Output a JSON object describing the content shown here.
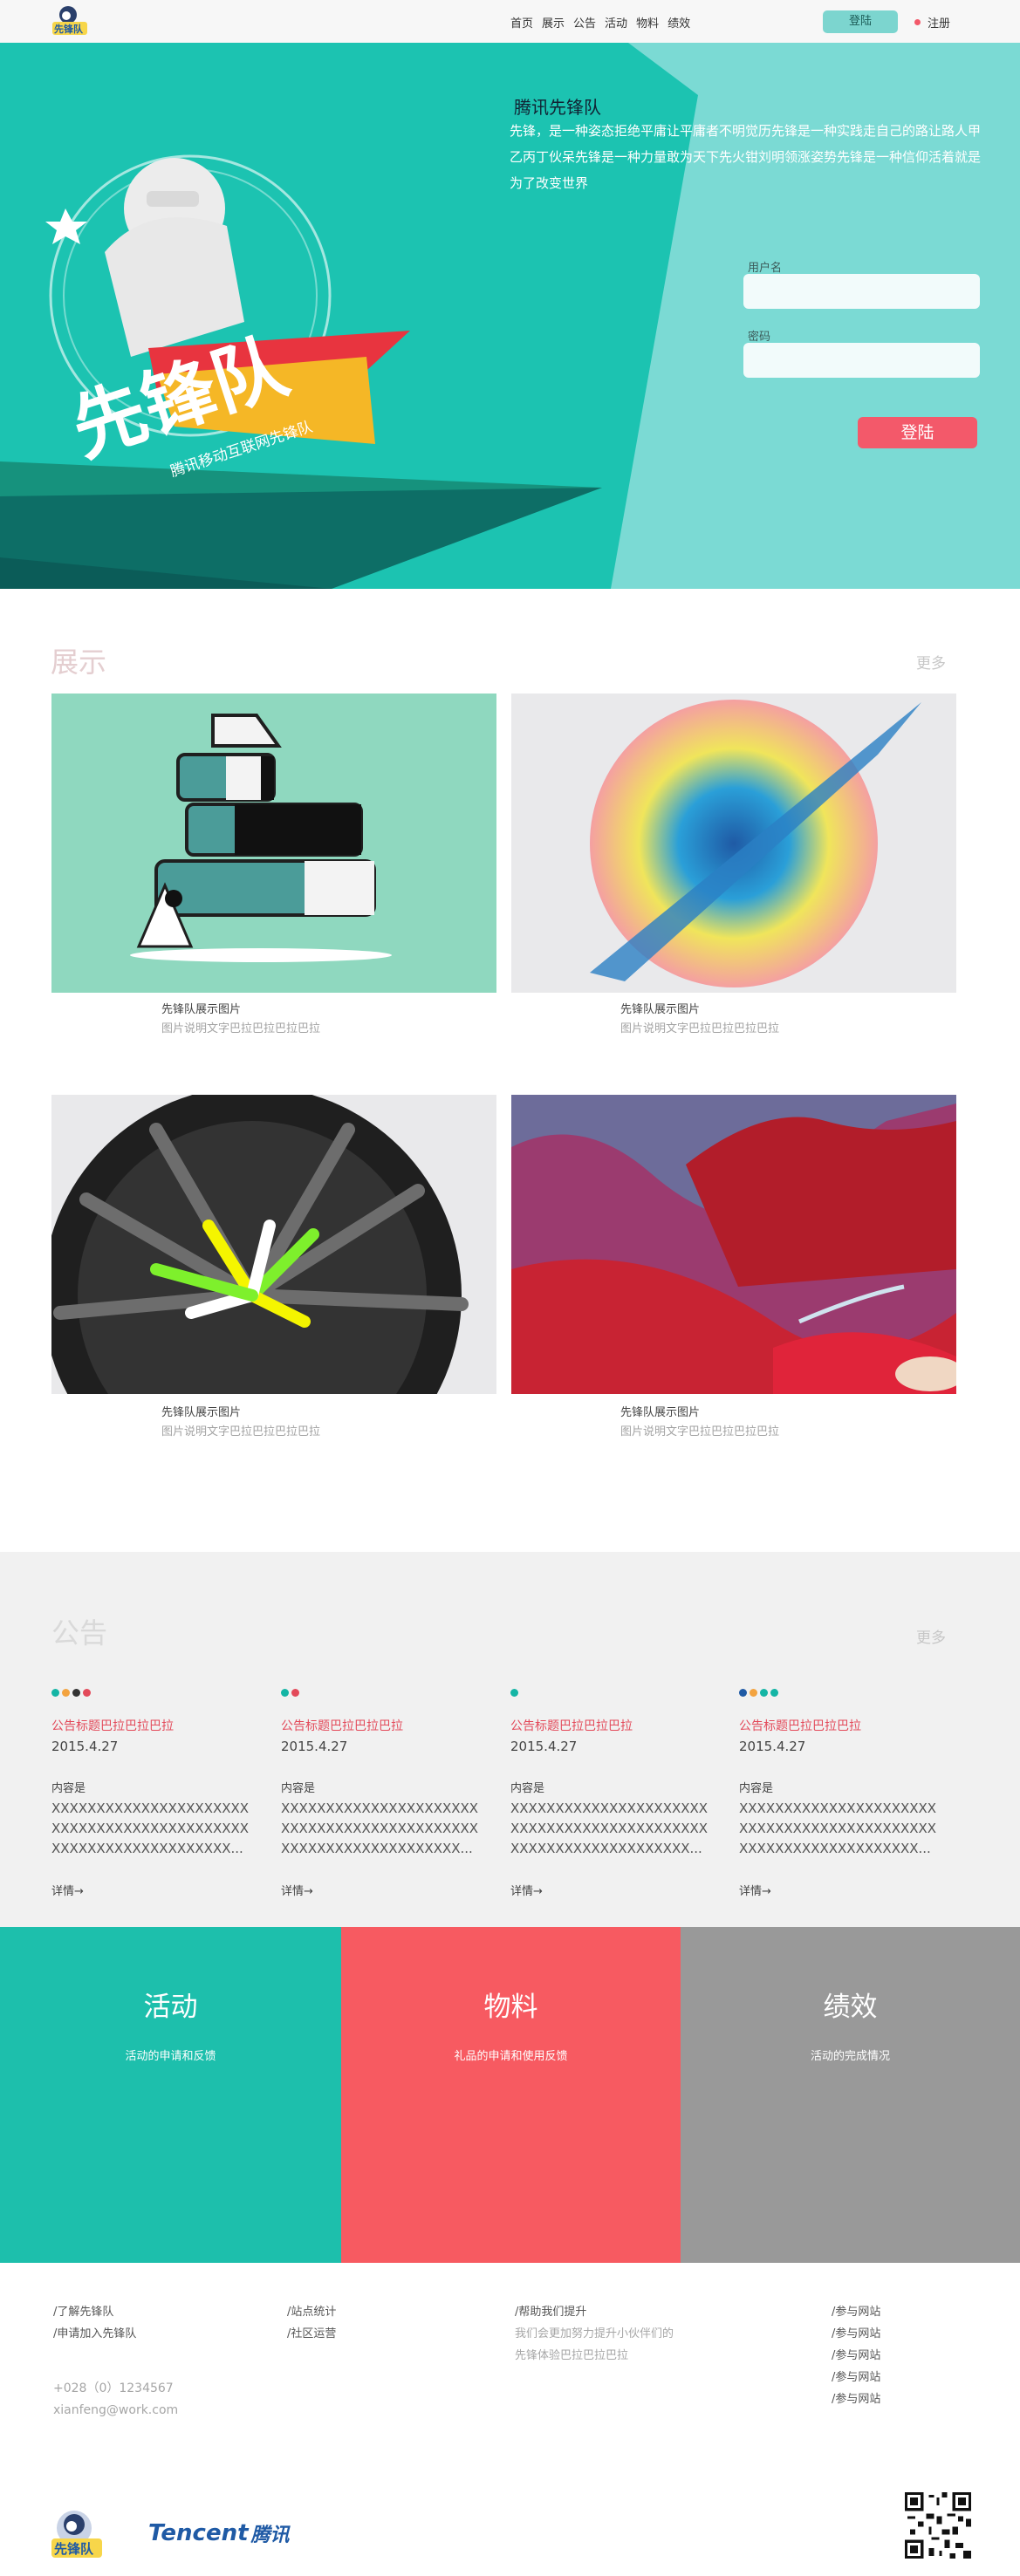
{
  "nav": {
    "logo_text": "先锋队",
    "links": [
      "首页",
      "展示",
      "公告",
      "活动",
      "物料",
      "绩效"
    ],
    "login_label": "登陆",
    "register_label": "注册"
  },
  "hero": {
    "logo_text": "先锋队",
    "logo_subtitle": "腾讯移动互联网先锋队",
    "title": "腾讯先锋队",
    "text": "先锋，是一种姿态拒绝平庸让平庸者不明觉历先锋是一种实践走自己的路让路人甲乙丙丁伙呆先锋是一种力量敢为天下先火钳刘明领涨姿势先锋是一种信仰活着就是为了改变世界",
    "username_label": "用户名",
    "password_label": "密码",
    "submit_label": "登陆"
  },
  "showcase": {
    "title": "展示",
    "more": "更多",
    "items": [
      {
        "title": "先锋队展示图片",
        "desc": "图片说明文字巴拉巴拉巴拉巴拉"
      },
      {
        "title": "先锋队展示图片",
        "desc": "图片说明文字巴拉巴拉巴拉巴拉"
      },
      {
        "title": "先锋队展示图片",
        "desc": "图片说明文字巴拉巴拉巴拉巴拉"
      },
      {
        "title": "先锋队展示图片",
        "desc": "图片说明文字巴拉巴拉巴拉巴拉"
      }
    ]
  },
  "notice": {
    "title": "公告",
    "more": "更多",
    "items": [
      {
        "title": "公告标题巴拉巴拉巴拉",
        "date": "2015.4.27",
        "content_label": "内容是",
        "content": "XXXXXXXXXXXXXXXXXXXXXXXXXXXXXXXXXXXXXXXXXXXXXXXXXXXXXXXXXXXXXXXX...",
        "more": "详情→",
        "dots": [
          "#14b5a5",
          "#f3a33f",
          "#333333",
          "#e34a5a"
        ]
      },
      {
        "title": "公告标题巴拉巴拉巴拉",
        "date": "2015.4.27",
        "content_label": "内容是",
        "content": "XXXXXXXXXXXXXXXXXXXXXXXXXXXXXXXXXXXXXXXXXXXXXXXXXXXXXXXXXXXXXXXX...",
        "more": "详情→",
        "dots": [
          "#14b5a5",
          "#e34a5a"
        ]
      },
      {
        "title": "公告标题巴拉巴拉巴拉",
        "date": "2015.4.27",
        "content_label": "内容是",
        "content": "XXXXXXXXXXXXXXXXXXXXXXXXXXXXXXXXXXXXXXXXXXXXXXXXXXXXXXXXXXXXXXXX...",
        "more": "详情→",
        "dots": [
          "#14b5a5"
        ]
      },
      {
        "title": "公告标题巴拉巴拉巴拉",
        "date": "2015.4.27",
        "content_label": "内容是",
        "content": "XXXXXXXXXXXXXXXXXXXXXXXXXXXXXXXXXXXXXXXXXXXXXXXXXXXXXXXXXXXXXXXX...",
        "more": "详情→",
        "dots": [
          "#1f5aa5",
          "#f3a33f",
          "#14b5a5",
          "#14b5a5"
        ]
      }
    ]
  },
  "features": [
    {
      "title": "活动",
      "subtitle": "活动的申请和反馈",
      "color": "#1dbfac"
    },
    {
      "title": "物料",
      "subtitle": "礼品的申请和使用反馈",
      "color": "#f75a61"
    },
    {
      "title": "绩效",
      "subtitle": "活动的完成情况",
      "color": "#999999"
    }
  ],
  "footer": {
    "col1": [
      "/了解先锋队",
      "/申请加入先锋队"
    ],
    "col2": [
      "/站点统计",
      "/社区运营"
    ],
    "col3_title": "/帮助我们提升",
    "col3_text": [
      "我们会更加努力提升小伙伴们的",
      "先锋体验巴拉巴拉巴拉"
    ],
    "col4": [
      "/参与网站",
      "/参与网站",
      "/参与网站",
      "/参与网站",
      "/参与网站"
    ],
    "phone": "+028（0）1234567",
    "email": "xianfeng@work.com",
    "logo_text": "先锋队",
    "tencent_en": "Tencent",
    "tencent_cn": "腾讯"
  },
  "colors": {
    "accent": "#1dbfac",
    "hero_bg": "#7bdad4",
    "brand_red": "#f3596a",
    "gray": "#999999"
  }
}
